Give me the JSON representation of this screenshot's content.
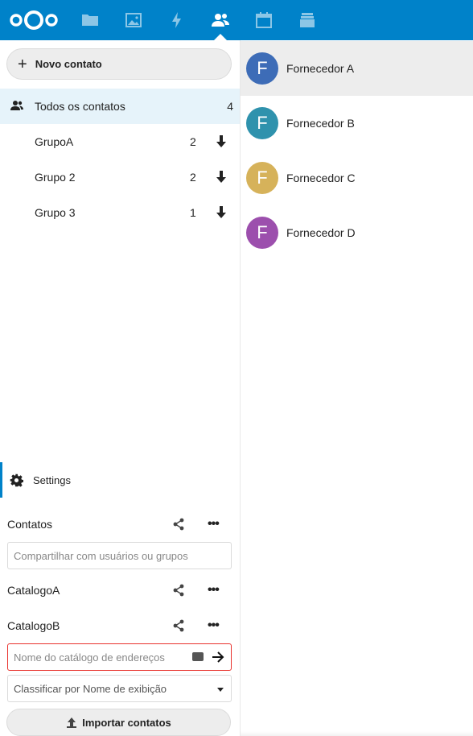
{
  "header": {
    "brand_color": "#0082c9",
    "apps": [
      {
        "icon": "files-icon"
      },
      {
        "icon": "photos-icon"
      },
      {
        "icon": "activity-icon"
      },
      {
        "icon": "contacts-icon",
        "active": true
      },
      {
        "icon": "calendar-icon"
      },
      {
        "icon": "deck-icon"
      }
    ]
  },
  "sidebar": {
    "new_contact_label": "Novo contato",
    "all_contacts": {
      "label": "Todos os contatos",
      "count": "4"
    },
    "groups": [
      {
        "label": "GrupoA",
        "count": "2"
      },
      {
        "label": "Grupo 2",
        "count": "2"
      },
      {
        "label": "Grupo 3",
        "count": "1"
      }
    ],
    "settings_label": "Settings",
    "addressbooks": [
      {
        "name": "Contatos"
      },
      {
        "name": "CatalogoA"
      },
      {
        "name": "CatalogoB"
      }
    ],
    "share_placeholder": "Compartilhar com usuários ou grupos",
    "new_addressbook_placeholder": "Nome do catálogo de endereços",
    "sort_selected": "Classificar por Nome de exibição",
    "import_label": "Importar contatos"
  },
  "contacts": [
    {
      "initial": "F",
      "name": "Fornecedor A",
      "color": "#3d6cb7",
      "selected": true
    },
    {
      "initial": "F",
      "name": "Fornecedor B",
      "color": "#2f92ad",
      "selected": false
    },
    {
      "initial": "F",
      "name": "Fornecedor C",
      "color": "#d6b25a",
      "selected": false
    },
    {
      "initial": "F",
      "name": "Fornecedor D",
      "color": "#9c4fad",
      "selected": false
    }
  ]
}
